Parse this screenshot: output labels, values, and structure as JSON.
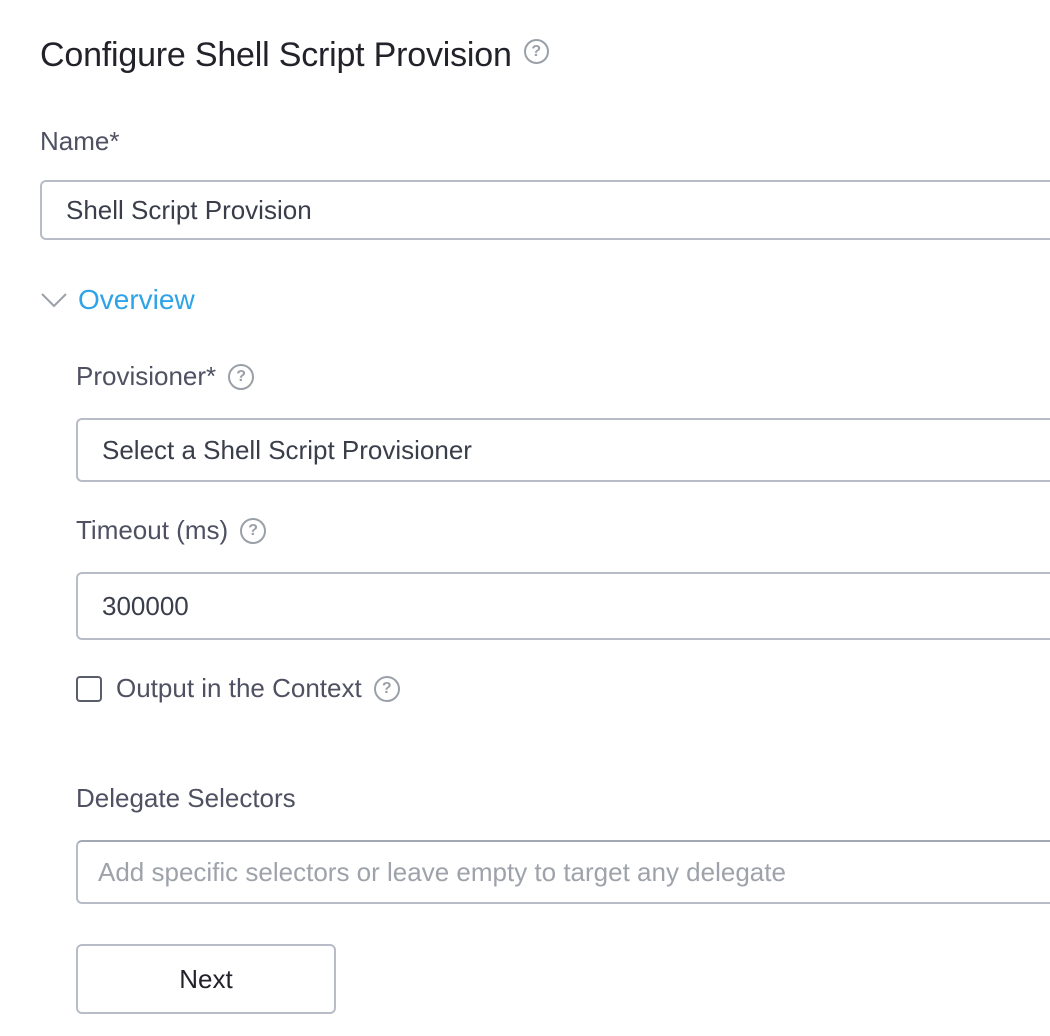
{
  "header": {
    "title": "Configure Shell Script Provision",
    "help_icon": "question-circle-icon"
  },
  "name_field": {
    "label": "Name*",
    "value": "Shell Script Provision"
  },
  "overview_section": {
    "label": "Overview",
    "expanded": true,
    "accent_color": "#2ea3e7"
  },
  "provisioner_field": {
    "label": "Provisioner*",
    "value": "Select a Shell Script Provisioner"
  },
  "timeout_field": {
    "label": "Timeout (ms)",
    "value": "300000"
  },
  "output_context": {
    "label": "Output in the Context",
    "checked": false
  },
  "delegate_selectors": {
    "label": "Delegate Selectors",
    "placeholder": "Add specific selectors or leave empty to target any delegate"
  },
  "next_button": {
    "label": "Next"
  }
}
